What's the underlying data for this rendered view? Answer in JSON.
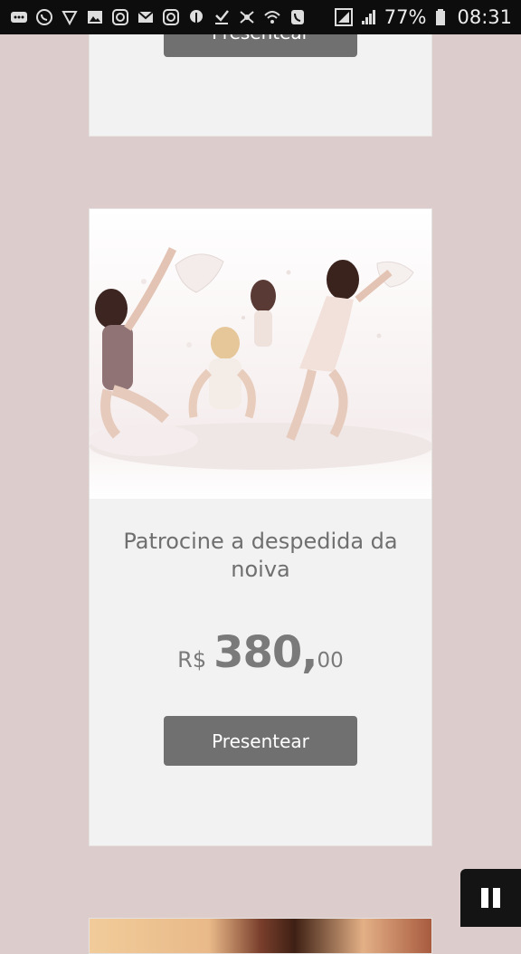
{
  "status_bar": {
    "left_icons": [
      "chat-bubble-icon",
      "whatsapp-icon",
      "heart-app-icon",
      "image-icon",
      "instagram-icon",
      "mail-icon",
      "instagram-icon",
      "pinterest-icon",
      "download-icon",
      "dots-icon",
      "wifi-calling-icon",
      "phone-icon"
    ],
    "battery_percent": "77%",
    "time": "08:31"
  },
  "cards": {
    "top": {
      "button_label": "Presentear"
    },
    "main": {
      "title": "Patrocine a despedida da noiva",
      "price_currency": "R$",
      "price_integer": "380,",
      "price_decimal": "00",
      "button_label": "Presentear"
    }
  },
  "colors": {
    "background": "#dccdcc",
    "card": "#f2f2f2",
    "button": "#707070",
    "text": "#6f6f6f"
  }
}
